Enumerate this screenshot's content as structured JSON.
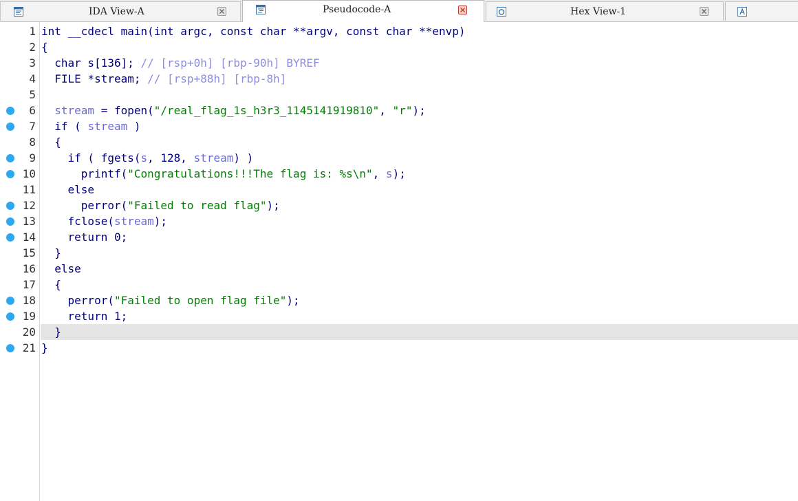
{
  "tabs": [
    {
      "label": "IDA View-A",
      "icon": "disassembly-view-icon",
      "active": false
    },
    {
      "label": "Pseudocode-A",
      "icon": "pseudocode-icon",
      "active": true
    },
    {
      "label": "Hex View-1",
      "icon": "hex-view-icon",
      "active": false
    },
    {
      "label": "",
      "icon": "structures-icon",
      "active": false
    }
  ],
  "colors": {
    "keyword": "#000080",
    "variable": "#6b6bd6",
    "string": "#008000",
    "comment": "#8c8ce0",
    "breakpoint": "#2ea8f0",
    "current_line": "#e4e4e4"
  },
  "code": {
    "current_line": 20,
    "lines": [
      {
        "no": "1",
        "bp": false,
        "tokens": [
          {
            "t": "int __cdecl main(int argc, const char **argv, const char **envp)",
            "c": "kw"
          }
        ]
      },
      {
        "no": "2",
        "bp": false,
        "tokens": [
          {
            "t": "{",
            "c": "punc"
          }
        ]
      },
      {
        "no": "3",
        "bp": false,
        "tokens": [
          {
            "t": "  char s[136]; ",
            "c": "kw"
          },
          {
            "t": "// [rsp+0h] [rbp-90h] BYREF",
            "c": "cmt"
          }
        ]
      },
      {
        "no": "4",
        "bp": false,
        "tokens": [
          {
            "t": "  FILE *stream; ",
            "c": "kw"
          },
          {
            "t": "// [rsp+88h] [rbp-8h]",
            "c": "cmt"
          }
        ]
      },
      {
        "no": "5",
        "bp": false,
        "tokens": [
          {
            "t": "",
            "c": "kw"
          }
        ]
      },
      {
        "no": "6",
        "bp": true,
        "tokens": [
          {
            "t": "  ",
            "c": "kw"
          },
          {
            "t": "stream",
            "c": "var"
          },
          {
            "t": " = fopen(",
            "c": "kw"
          },
          {
            "t": "\"/real_flag_1s_h3r3_1145141919810\"",
            "c": "str"
          },
          {
            "t": ", ",
            "c": "kw"
          },
          {
            "t": "\"r\"",
            "c": "str"
          },
          {
            "t": ");",
            "c": "kw"
          }
        ]
      },
      {
        "no": "7",
        "bp": true,
        "tokens": [
          {
            "t": "  if ( ",
            "c": "kw"
          },
          {
            "t": "stream",
            "c": "var"
          },
          {
            "t": " )",
            "c": "kw"
          }
        ]
      },
      {
        "no": "8",
        "bp": false,
        "tokens": [
          {
            "t": "  {",
            "c": "punc"
          }
        ]
      },
      {
        "no": "9",
        "bp": true,
        "tokens": [
          {
            "t": "    if ( fgets(",
            "c": "kw"
          },
          {
            "t": "s",
            "c": "var"
          },
          {
            "t": ", 128, ",
            "c": "kw"
          },
          {
            "t": "stream",
            "c": "var"
          },
          {
            "t": ") )",
            "c": "kw"
          }
        ]
      },
      {
        "no": "10",
        "bp": true,
        "tokens": [
          {
            "t": "      printf(",
            "c": "kw"
          },
          {
            "t": "\"Congratulations!!!The flag is: %s\\n\"",
            "c": "str"
          },
          {
            "t": ", ",
            "c": "kw"
          },
          {
            "t": "s",
            "c": "var"
          },
          {
            "t": ");",
            "c": "kw"
          }
        ]
      },
      {
        "no": "11",
        "bp": false,
        "tokens": [
          {
            "t": "    else",
            "c": "kw"
          }
        ]
      },
      {
        "no": "12",
        "bp": true,
        "tokens": [
          {
            "t": "      perror(",
            "c": "kw"
          },
          {
            "t": "\"Failed to read flag\"",
            "c": "str"
          },
          {
            "t": ");",
            "c": "kw"
          }
        ]
      },
      {
        "no": "13",
        "bp": true,
        "tokens": [
          {
            "t": "    fclose(",
            "c": "kw"
          },
          {
            "t": "stream",
            "c": "var"
          },
          {
            "t": ");",
            "c": "kw"
          }
        ]
      },
      {
        "no": "14",
        "bp": true,
        "tokens": [
          {
            "t": "    return 0;",
            "c": "kw"
          }
        ]
      },
      {
        "no": "15",
        "bp": false,
        "tokens": [
          {
            "t": "  }",
            "c": "punc"
          }
        ]
      },
      {
        "no": "16",
        "bp": false,
        "tokens": [
          {
            "t": "  else",
            "c": "kw"
          }
        ]
      },
      {
        "no": "17",
        "bp": false,
        "tokens": [
          {
            "t": "  {",
            "c": "punc"
          }
        ]
      },
      {
        "no": "18",
        "bp": true,
        "tokens": [
          {
            "t": "    perror(",
            "c": "kw"
          },
          {
            "t": "\"Failed to open flag file\"",
            "c": "str"
          },
          {
            "t": ");",
            "c": "kw"
          }
        ]
      },
      {
        "no": "19",
        "bp": true,
        "tokens": [
          {
            "t": "    return 1;",
            "c": "kw"
          }
        ]
      },
      {
        "no": "20",
        "bp": false,
        "tokens": [
          {
            "t": "  }",
            "c": "punc"
          }
        ]
      },
      {
        "no": "21",
        "bp": true,
        "tokens": [
          {
            "t": "}",
            "c": "punc"
          }
        ]
      }
    ]
  }
}
